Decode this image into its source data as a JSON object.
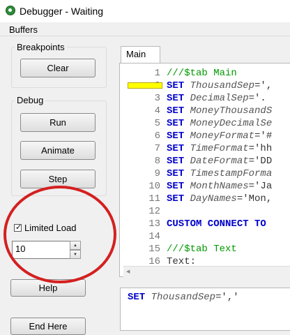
{
  "window": {
    "title": "Debugger - Waiting",
    "icon": "qlikview-app-icon"
  },
  "menu": {
    "items": [
      {
        "label": "Buffers"
      }
    ]
  },
  "breakpoints": {
    "label": "Breakpoints",
    "clear_label": "Clear"
  },
  "debug": {
    "label": "Debug",
    "run_label": "Run",
    "animate_label": "Animate",
    "step_label": "Step"
  },
  "limited_load": {
    "label": "Limited Load",
    "checked": true,
    "value": "10"
  },
  "help_label": "Help",
  "end_here_label": "End Here",
  "editor": {
    "tab_label": "Main",
    "lines": [
      {
        "num": "1",
        "parts": [
          {
            "t": "///$tab Main",
            "c": "cm"
          }
        ]
      },
      {
        "num": "2",
        "parts": [
          {
            "t": "SET ",
            "c": "kw"
          },
          {
            "t": "ThousandSep",
            "c": "var"
          },
          {
            "t": "=',",
            "c": "str"
          }
        ]
      },
      {
        "num": "3",
        "parts": [
          {
            "t": "SET ",
            "c": "kw"
          },
          {
            "t": "DecimalSep",
            "c": "var"
          },
          {
            "t": "='.",
            "c": "str"
          }
        ]
      },
      {
        "num": "4",
        "parts": [
          {
            "t": "SET ",
            "c": "kw"
          },
          {
            "t": "MoneyThousandS",
            "c": "var"
          }
        ]
      },
      {
        "num": "5",
        "parts": [
          {
            "t": "SET ",
            "c": "kw"
          },
          {
            "t": "MoneyDecimalSe",
            "c": "var"
          }
        ]
      },
      {
        "num": "6",
        "parts": [
          {
            "t": "SET ",
            "c": "kw"
          },
          {
            "t": "MoneyFormat",
            "c": "var"
          },
          {
            "t": "='#",
            "c": "str"
          }
        ]
      },
      {
        "num": "7",
        "parts": [
          {
            "t": "SET ",
            "c": "kw"
          },
          {
            "t": "TimeFormat",
            "c": "var"
          },
          {
            "t": "='hh",
            "c": "str"
          }
        ]
      },
      {
        "num": "8",
        "parts": [
          {
            "t": "SET ",
            "c": "kw"
          },
          {
            "t": "DateFormat",
            "c": "var"
          },
          {
            "t": "='DD",
            "c": "str"
          }
        ]
      },
      {
        "num": "9",
        "parts": [
          {
            "t": "SET ",
            "c": "kw"
          },
          {
            "t": "TimestampForma",
            "c": "var"
          }
        ]
      },
      {
        "num": "10",
        "parts": [
          {
            "t": "SET ",
            "c": "kw"
          },
          {
            "t": "MonthNames",
            "c": "var"
          },
          {
            "t": "='Ja",
            "c": "str"
          }
        ]
      },
      {
        "num": "11",
        "parts": [
          {
            "t": "SET ",
            "c": "kw"
          },
          {
            "t": "DayNames",
            "c": "var"
          },
          {
            "t": "='Mon,",
            "c": "str"
          }
        ]
      },
      {
        "num": "12",
        "parts": []
      },
      {
        "num": "13",
        "parts": [
          {
            "t": "CUSTOM CONNECT TO",
            "c": "kw"
          }
        ]
      },
      {
        "num": "14",
        "parts": []
      },
      {
        "num": "15",
        "parts": [
          {
            "t": "///$tab Text",
            "c": "cm"
          }
        ]
      },
      {
        "num": "16",
        "parts": [
          {
            "t": "Text:",
            "c": "str"
          }
        ]
      }
    ]
  },
  "current_statement": {
    "parts": [
      {
        "t": "SET ",
        "c": "kw"
      },
      {
        "t": "ThousandSep",
        "c": "var"
      },
      {
        "t": "=','",
        "c": "str"
      }
    ]
  },
  "colors": {
    "breakpoint_marker": "#ffff00",
    "annotation_circle": "#d42020",
    "keyword": "#0000cc",
    "comment": "#009900"
  }
}
